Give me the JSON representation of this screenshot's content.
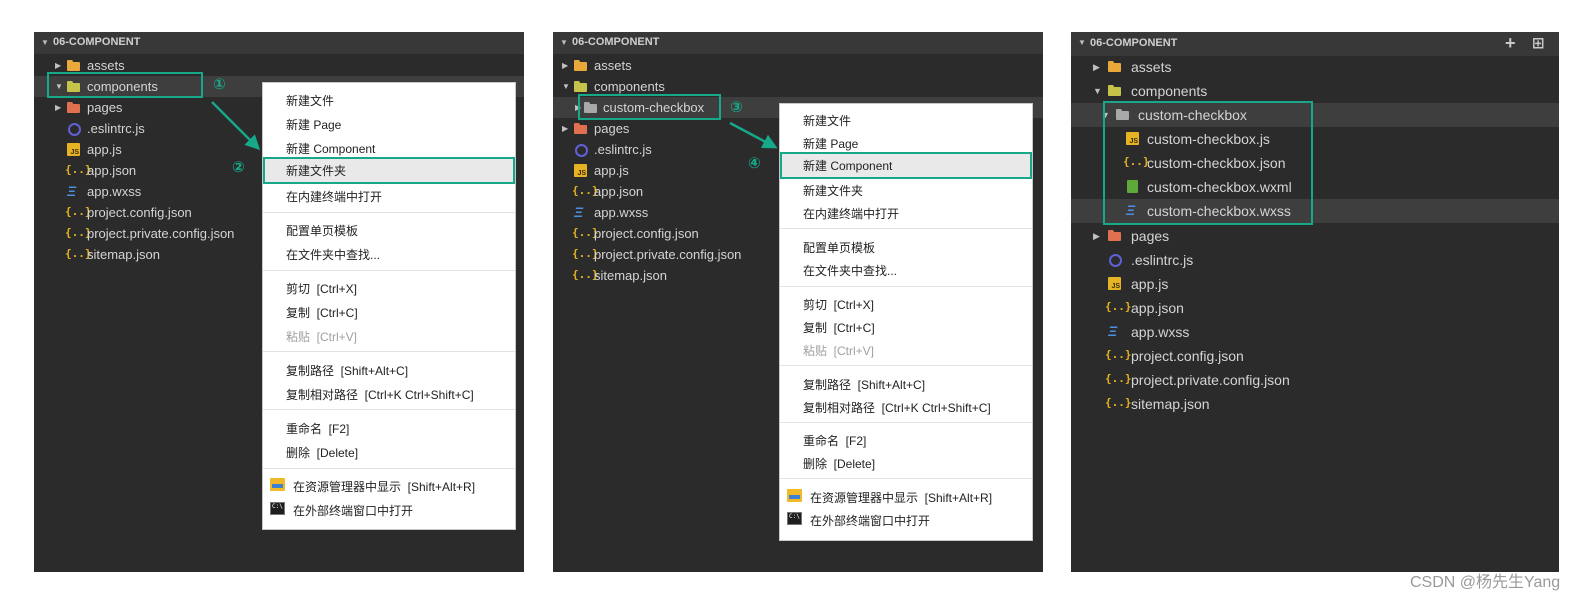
{
  "panel1": {
    "header": "06-COMPONENT",
    "rows": [
      "assets",
      "components",
      "pages",
      ".eslintrc.js",
      "app.js",
      "app.json",
      "app.wxss",
      "project.config.json",
      "project.private.config.json",
      "sitemap.json"
    ],
    "badges": [
      "①",
      "②"
    ],
    "menu": [
      "新建文件",
      "新建 Page",
      "新建 Component",
      "新建文件夹",
      "在内建终端中打开",
      "配置单页模板",
      "在文件夹中查找...",
      "剪切  [Ctrl+X]",
      "复制  [Ctrl+C]",
      "粘贴  [Ctrl+V]",
      "复制路径  [Shift+Alt+C]",
      "复制相对路径  [Ctrl+K Ctrl+Shift+C]",
      "重命名  [F2]",
      "删除  [Delete]",
      "在资源管理器中显示  [Shift+Alt+R]",
      "在外部终端窗口中打开"
    ]
  },
  "panel2": {
    "header": "06-COMPONENT",
    "rows": [
      "assets",
      "components",
      "custom-checkbox",
      "pages",
      ".eslintrc.js",
      "app.js",
      "app.json",
      "app.wxss",
      "project.config.json",
      "project.private.config.json",
      "sitemap.json"
    ],
    "badges": [
      "③",
      "④"
    ],
    "menu": [
      "新建文件",
      "新建 Page",
      "新建 Component",
      "新建文件夹",
      "在内建终端中打开",
      "配置单页模板",
      "在文件夹中查找...",
      "剪切  [Ctrl+X]",
      "复制  [Ctrl+C]",
      "粘贴  [Ctrl+V]",
      "复制路径  [Shift+Alt+C]",
      "复制相对路径  [Ctrl+K Ctrl+Shift+C]",
      "重命名  [F2]",
      "删除  [Delete]",
      "在资源管理器中显示  [Shift+Alt+R]",
      "在外部终端窗口中打开"
    ]
  },
  "panel3": {
    "header": "06-COMPONENT",
    "header_buttons": [
      "+",
      "⊞"
    ],
    "rows": [
      "assets",
      "components",
      "custom-checkbox",
      "custom-checkbox.js",
      "custom-checkbox.json",
      "custom-checkbox.wxml",
      "custom-checkbox.wxss",
      "pages",
      ".eslintrc.js",
      "app.js",
      "app.json",
      "app.wxss",
      "project.config.json",
      "project.private.config.json",
      "sitemap.json"
    ]
  },
  "icons": {
    "caret_right": "▶",
    "caret_down": "▼",
    "json_glyph": "{..}",
    "css_glyph": "Ξ",
    "js_glyph": "JS"
  },
  "colors": {
    "panel_bg": "#2b2b2b",
    "accent": "#17a789",
    "menu_bg": "#ffffff"
  },
  "watermark": "CSDN @杨先生Yang"
}
